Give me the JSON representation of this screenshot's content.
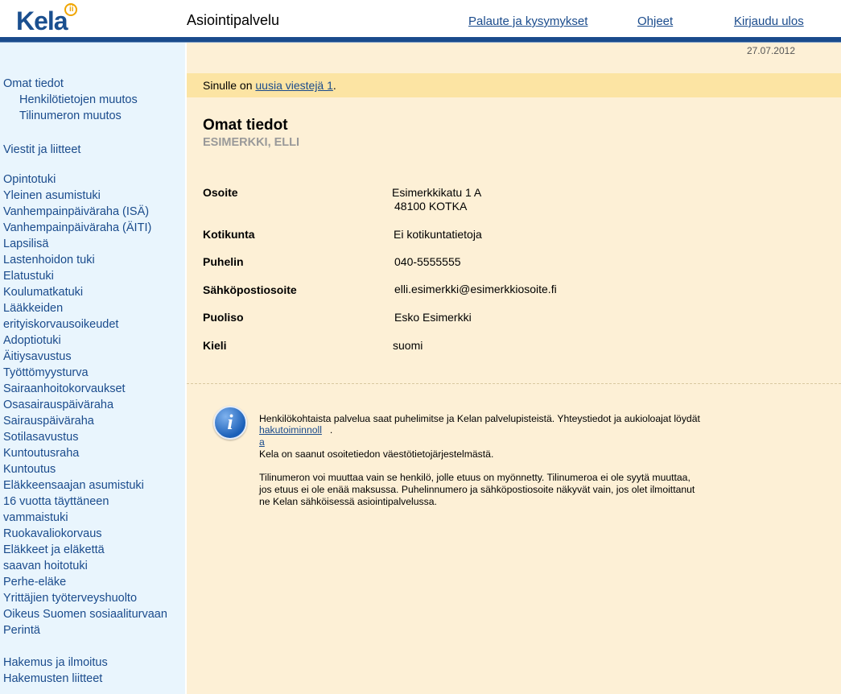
{
  "header": {
    "logo_text": "Kela",
    "app_title": "Asiointipalvelu",
    "links": [
      "Palaute ja kysymykset",
      "Ohjeet",
      "Kirjaudu ulos"
    ]
  },
  "sidebar": {
    "groups": [
      [
        "Omat tiedot",
        "Henkilötietojen muutos",
        "Tilinumeron muutos"
      ],
      [
        "Viestit ja liitteet"
      ],
      [
        "Opintotuki",
        "Yleinen asumistuki",
        "Vanhempainpäiväraha (ISÄ)",
        "Vanhempainpäiväraha (ÄITI)",
        "Lapsilisä",
        "Lastenhoidon tuki",
        "Elatustuki",
        "Koulumatkatuki",
        "Lääkkeiden",
        "erityiskorvausoikeudet",
        "Adoptiotuki",
        "Äitiysavustus",
        "Työttömyysturva",
        "Sairaanhoitokorvaukset",
        "Osasairauspäiväraha",
        "Sairauspäiväraha",
        "Sotilasavustus",
        "Kuntoutusraha",
        "Kuntoutus",
        "Eläkkeensaajan asumistuki",
        "16 vuotta täyttäneen",
        "vammaistuki",
        "Ruokavaliokorvaus",
        "Eläkkeet ja eläkettä",
        "saavan hoitotuki",
        "Perhe-eläke",
        "Yrittäjien työterveyshuolto",
        "Oikeus Suomen sosiaaliturvaan",
        "Perintä"
      ],
      [
        "Hakemus ja ilmoitus",
        "Hakemusten liitteet"
      ]
    ]
  },
  "main": {
    "date": "27.07.2012",
    "message_prefix": "Sinulle on ",
    "message_link": "uusia viestejä 1",
    "message_suffix": ".",
    "title": "Omat tiedot",
    "name": "ESIMERKKI, ELLI",
    "fields": [
      {
        "label": "Osoite",
        "value": "Esimerkkikatu 1 A",
        "value2": "48100 KOTKA"
      },
      {
        "label": "Kotikunta",
        "value": "Ei kotikuntatietoja"
      },
      {
        "label": "Puhelin",
        "value": "040-5555555"
      },
      {
        "label": "Sähköpostiosoite",
        "value": "elli.esimerkki@esimerkkiosoite.fi"
      },
      {
        "label": "Puoliso",
        "value": "Esko Esimerkki"
      },
      {
        "label": "Kieli",
        "value": "suomi"
      }
    ],
    "info": {
      "line1": "Henkilökohtaista palvelua saat puhelimitse ja Kelan palvelupisteistä. Yhteystiedot ja aukioloajat löydät",
      "link_part1": "hakutoiminnoll",
      "link_part2": "a",
      "link_suffix": ".",
      "line3": "Kela on saanut osoitetiedon väestötietojärjestelmästä.",
      "para2_line1": "Tilinumeron voi muuttaa vain se henkilö, jolle etuus on myönnetty. Tilinumeroa ei ole syytä muuttaa,",
      "para2_line2": "jos etuus ei ole enää maksussa. Puhelinnumero ja sähköpostiosoite näkyvät vain, jos olet ilmoittanut",
      "para2_line3": "ne Kelan sähköisessä asiointipalvelussa."
    }
  }
}
